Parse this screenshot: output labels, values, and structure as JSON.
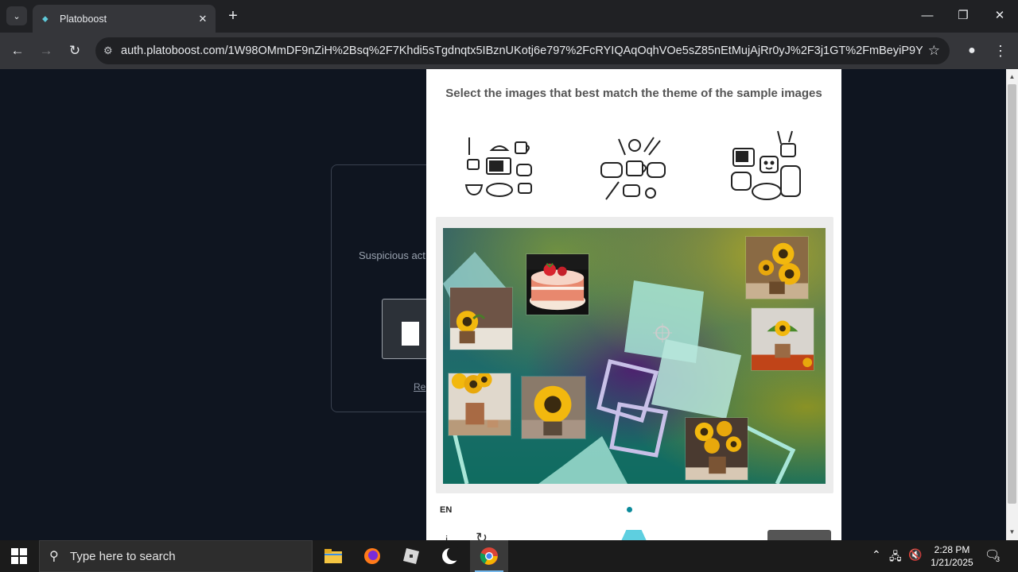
{
  "browser": {
    "tab_title": "Platoboost",
    "url": "auth.platoboost.com/1W98OMmDF9nZiH%2Bsq%2F7Khdi5sTgdnqtx5IBznUKotj6e797%2FcRYIQAqOqhVOe5sZ85nEtMujAjRr0yJ%2F3j1GT%2FmBeyiP9YaLx11WI...",
    "window_controls": {
      "minimize": "—",
      "maximize": "❐",
      "close": "✕"
    },
    "new_tab": "+",
    "tab_close": "✕"
  },
  "background_page": {
    "text_fragment": "Suspicious act",
    "link_fragment": "Re"
  },
  "captcha": {
    "prompt": "Select the images that best match the theme of the sample images",
    "samples": [
      "kitchen-items-sketch-1",
      "kitchen-items-sketch-2",
      "kitchen-items-sketch-3"
    ],
    "tiles": [
      "strawberry-cake",
      "sunflower-pot-top-right",
      "sunflower-on-table",
      "sunflower-pot-right",
      "sunflower-bunch-left",
      "sunflower-bloom",
      "sunflower-pot-bottom"
    ],
    "language": "EN",
    "page_indicator": "1"
  },
  "taskbar": {
    "search_placeholder": "Type here to search",
    "time": "2:28 PM",
    "date": "1/21/2025",
    "notification_count": "3"
  },
  "colors": {
    "chrome_dark": "#202124",
    "chrome_toolbar": "#35363a",
    "page_bg": "#0f1520",
    "accent": "#0a8a9a"
  }
}
